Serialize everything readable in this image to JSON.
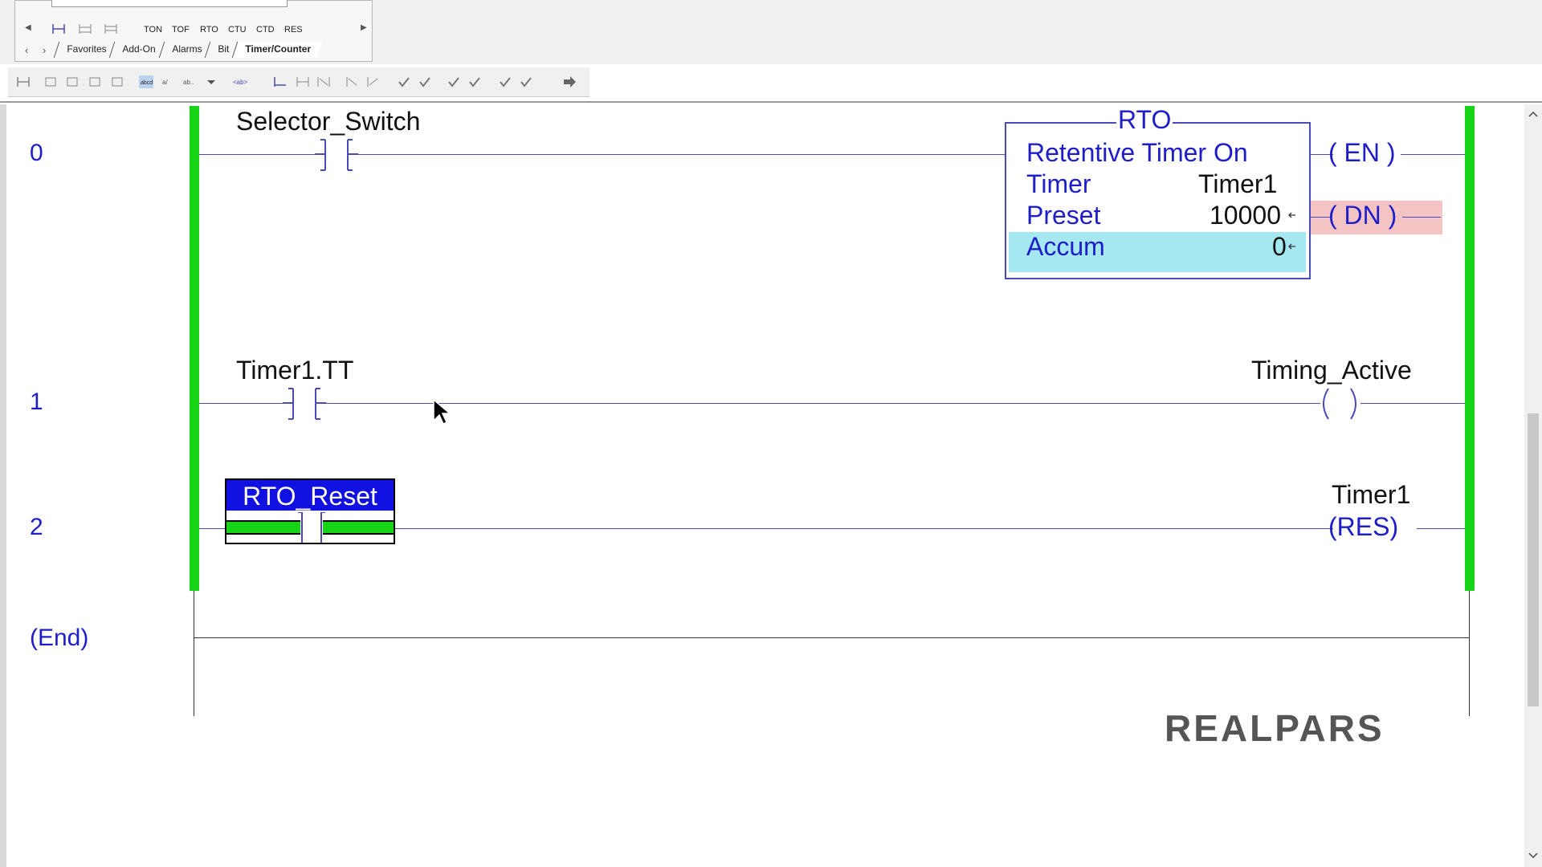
{
  "palette": {
    "instructions": [
      "TON",
      "TOF",
      "RTO",
      "CTU",
      "CTD",
      "RES"
    ],
    "tabs": [
      {
        "label": "Favorites"
      },
      {
        "label": "Add-On"
      },
      {
        "label": "Alarms"
      },
      {
        "label": "Bit"
      },
      {
        "label": "Timer/Counter",
        "active": true
      }
    ]
  },
  "rungs": {
    "r0": {
      "number": "0",
      "contact_tag": "Selector_Switch",
      "block": {
        "type": "RTO",
        "description": "Retentive Timer On",
        "timer_label": "Timer",
        "timer_value": "Timer1",
        "preset_label": "Preset",
        "preset_value": "10000",
        "accum_label": "Accum",
        "accum_value": "0"
      },
      "coil_en": "EN",
      "coil_dn": "DN"
    },
    "r1": {
      "number": "1",
      "contact_tag": "Timer1.TT",
      "coil_tag": "Timing_Active"
    },
    "r2": {
      "number": "2",
      "contact_tag": "RTO_Reset",
      "coil_tag": "Timer1",
      "coil_type": "RES"
    },
    "end": "(End)"
  },
  "branding": {
    "logo": "REALPARS"
  },
  "colors": {
    "rail_green": "#17d417",
    "instruction_blue": "#1d1dc9",
    "accum_highlight": "#a6e8f2",
    "dn_highlight": "#f4c4c4",
    "selected_tag_bg": "#1010e0"
  }
}
